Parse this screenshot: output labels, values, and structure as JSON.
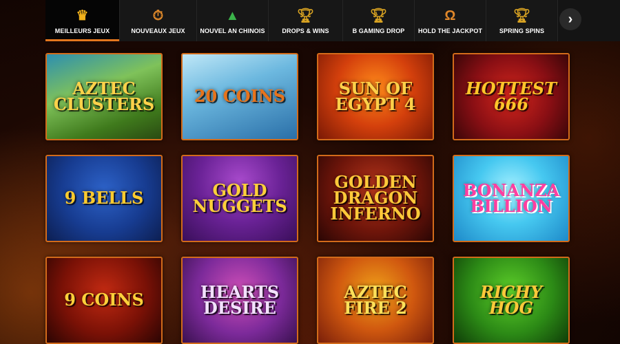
{
  "nav": {
    "tabs": [
      {
        "label": "MEILLEURS JEUX",
        "icon": "crown-icon",
        "active": true
      },
      {
        "label": "NOUVEAUX JEUX",
        "icon": "stopwatch-icon",
        "active": false
      },
      {
        "label": "NOUVEL AN CHINOIS",
        "icon": "christmas-tree-icon",
        "active": false
      },
      {
        "label": "DROPS & WINS",
        "icon": "trophy-icon",
        "active": false
      },
      {
        "label": "B GAMING DROP",
        "icon": "trophy-icon",
        "active": false
      },
      {
        "label": "HOLD THE JACKPOT",
        "icon": "horseshoe-icon",
        "active": false
      },
      {
        "label": "SPRING SPINS",
        "icon": "trophy-icon",
        "active": false
      }
    ],
    "next_icon": "chevron-right-icon",
    "next_glyph": "›"
  },
  "colors": {
    "accent": "#e4771e",
    "card_border": "#d36b1a",
    "nav_bg": "#141414"
  },
  "games": [
    {
      "title": "Aztec Clusters"
    },
    {
      "title": "20 Coins"
    },
    {
      "title": "Sun of Egypt 4"
    },
    {
      "title": "Hottest 666"
    },
    {
      "title": "9 Bells"
    },
    {
      "title": "Gold Nuggets"
    },
    {
      "title": "Golden Dragon Inferno"
    },
    {
      "title": "Bonanza Billion"
    },
    {
      "title": "9 Coins"
    },
    {
      "title": "Hearts Desire"
    },
    {
      "title": "Aztec Fire 2"
    },
    {
      "title": "Richy Hog"
    }
  ]
}
